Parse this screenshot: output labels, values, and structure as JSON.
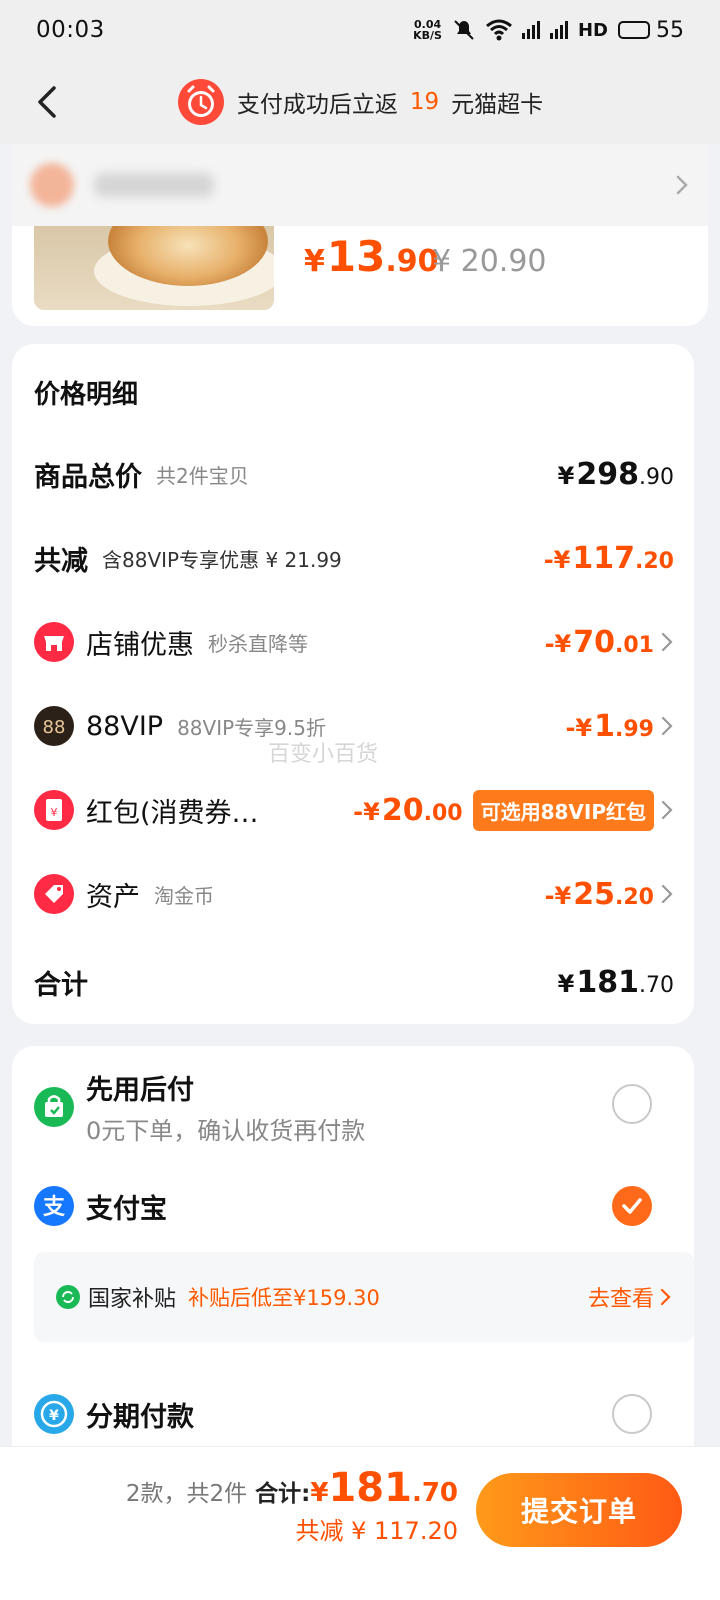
{
  "status_bar": {
    "time": "00:03",
    "net_speed_top": "0.04",
    "net_speed_bottom": "KB/S",
    "hd": "HD",
    "battery": "55"
  },
  "header": {
    "promo_prefix": "支付成功后立返",
    "promo_amount": "19",
    "promo_suffix": "元猫超卡"
  },
  "product": {
    "price_symbol": "¥",
    "price_int": "13",
    "price_dec": ".90",
    "original_price": "¥ 20.90"
  },
  "price_detail": {
    "title": "价格明细",
    "goods_total": {
      "label": "商品总价",
      "sub": "共2件宝贝",
      "sym": "¥",
      "int": "298",
      "dec": ".90"
    },
    "total_reduce": {
      "label": "共减",
      "sub": "含88VIP专享优惠 ¥ 21.99",
      "sym": "-¥",
      "int": "117",
      "dec": ".20"
    },
    "shop_discount": {
      "label": "店铺优惠",
      "sub": "秒杀直降等",
      "sym": "-¥",
      "int": "70",
      "dec": ".01"
    },
    "vip": {
      "label": "88VIP",
      "sub": "88VIP专享9.5折",
      "sym": "-¥",
      "int": "1",
      "dec": ".99"
    },
    "red_packet": {
      "label": "红包(消费券…",
      "sym": "-¥",
      "int": "20",
      "dec": ".00",
      "tag": "可选用88VIP红包"
    },
    "assets": {
      "label": "资产",
      "sub": "淘金币",
      "sym": "-¥",
      "int": "25",
      "dec": ".20"
    },
    "sum": {
      "label": "合计",
      "sym": "¥",
      "int": "181",
      "dec": ".70"
    },
    "watermark": "百变小百货"
  },
  "payment": {
    "pay_later": {
      "title": "先用后付",
      "desc": "0元下单，确认收货再付款"
    },
    "alipay": {
      "title": "支付宝"
    },
    "subsidy": {
      "label": "国家补贴",
      "note": "补贴后低至¥159.30",
      "link": "去查看"
    },
    "installment": {
      "title": "分期付款"
    }
  },
  "bottom": {
    "count": "2款，共2件",
    "total_label": "合计:",
    "total_sym": "¥",
    "total_int": "181",
    "total_dec": ".70",
    "saved": "共减 ¥ 117.20",
    "submit": "提交订单"
  },
  "colors": {
    "accent": "#ff5000",
    "tag_bg": "#ff7a1a",
    "page_bg": "#f0f2f5"
  }
}
